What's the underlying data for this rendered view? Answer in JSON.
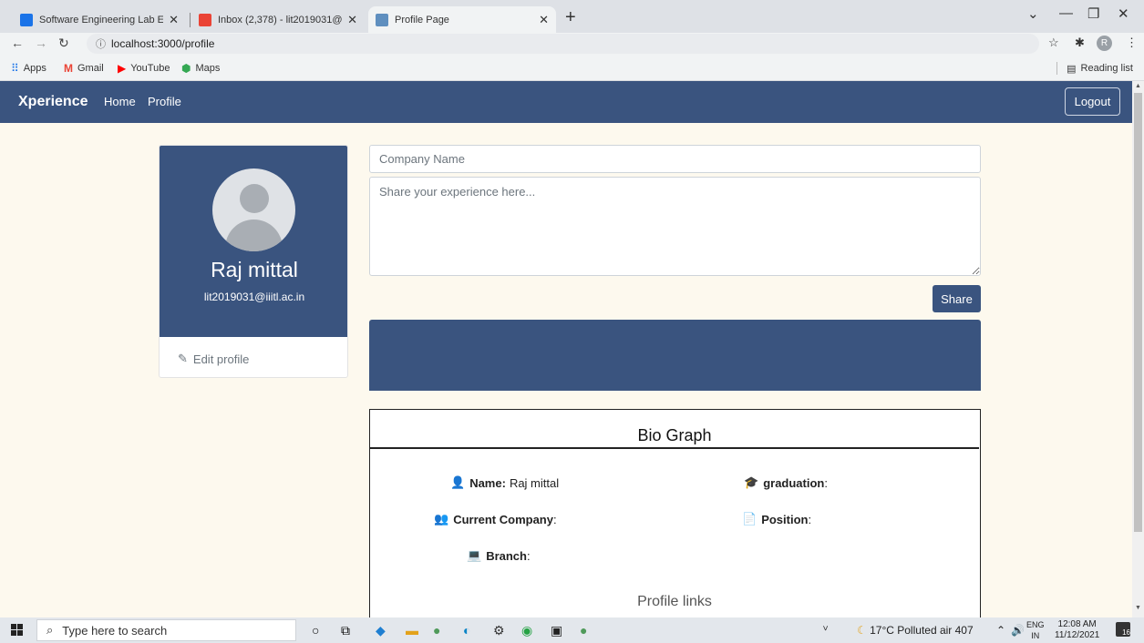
{
  "browser": {
    "tabs": [
      {
        "title": "Software Engineering Lab E",
        "favicon_color": "#1a73e8"
      },
      {
        "title": "Inbox (2,378) - lit2019031@iiitl.ac",
        "favicon_color": "#ea4335"
      },
      {
        "title": "Profile Page",
        "favicon_color": "#5f8fbf"
      }
    ],
    "url": "localhost:3000/profile",
    "profile_initial": "R",
    "bookmarks": [
      {
        "label": "Apps",
        "icon": "apps-grid-icon"
      },
      {
        "label": "Gmail",
        "icon": "gmail-icon"
      },
      {
        "label": "YouTube",
        "icon": "youtube-icon"
      },
      {
        "label": "Maps",
        "icon": "maps-icon"
      }
    ],
    "reading_list": "Reading list"
  },
  "app": {
    "brand": "Xperience",
    "nav": [
      "Home",
      "Profile"
    ],
    "logout_label": "Logout",
    "accent_color": "#3a547f"
  },
  "profile": {
    "name": "Raj mittal",
    "email": "lit2019031@iiitl.ac.in",
    "edit_label": "Edit profile"
  },
  "post_form": {
    "company_placeholder": "Company Name",
    "experience_placeholder": "Share your experience here...",
    "share_label": "Share"
  },
  "bio": {
    "title": "Bio Graph",
    "fields": [
      {
        "label": "Name:",
        "value": "Raj mittal",
        "icon": "user-icon"
      },
      {
        "label": "graduation",
        "value": ":",
        "icon": "graduate-icon"
      },
      {
        "label": "Current Company",
        "value": ":",
        "icon": "office-worker-icon"
      },
      {
        "label": "Position",
        "value": ":",
        "icon": "file-code-icon"
      },
      {
        "label": "Branch",
        "value": ":",
        "icon": "laptop-icon"
      }
    ],
    "links_title": "Profile links"
  },
  "taskbar": {
    "search_placeholder": "Type here to search",
    "weather": "17°C  Polluted air 407",
    "lang_top": "ENG",
    "lang_bottom": "IN",
    "time": "12:08 AM",
    "date": "11/12/2021",
    "notification_count": "16"
  }
}
